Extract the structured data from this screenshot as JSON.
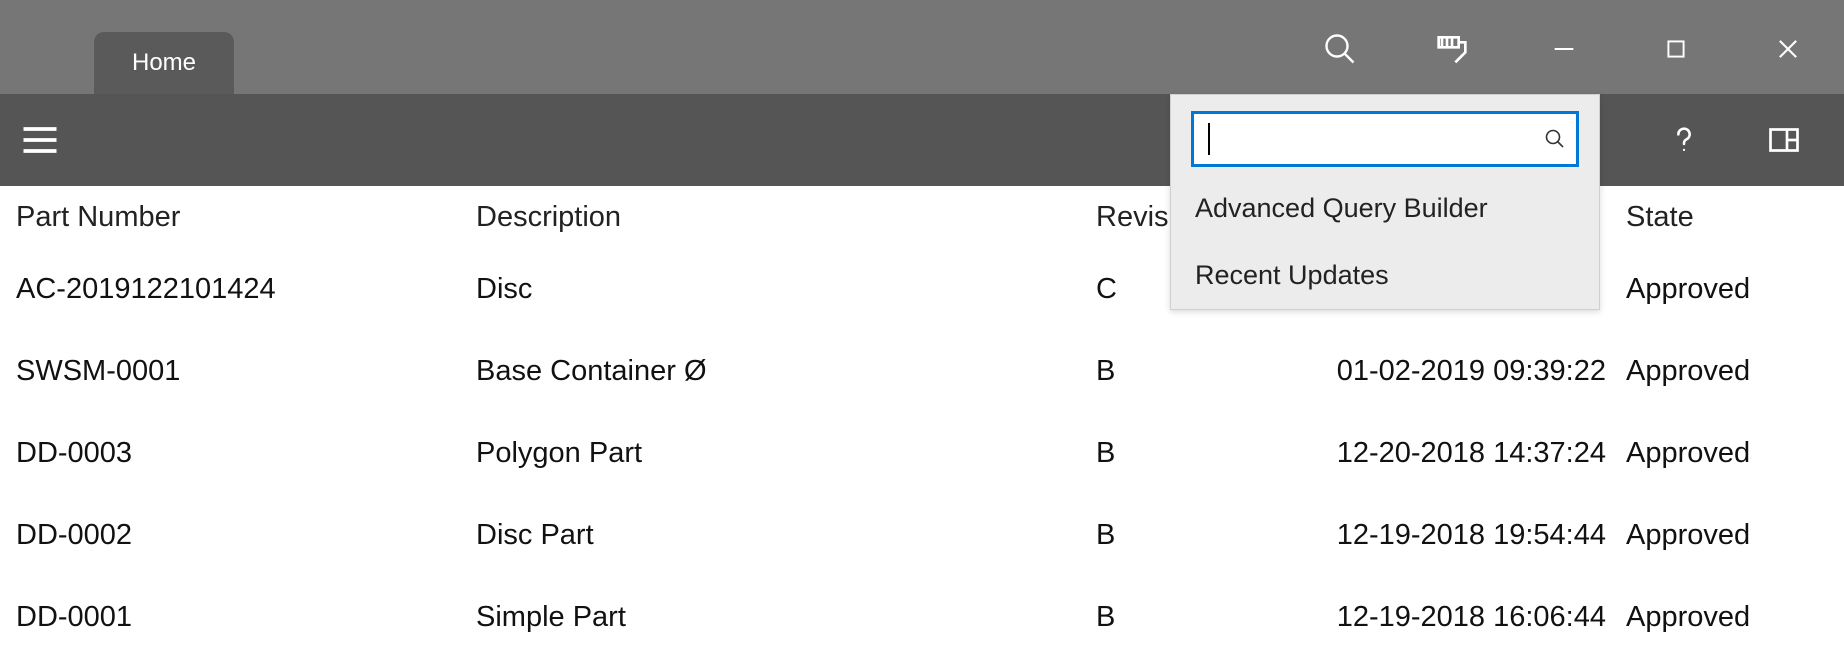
{
  "tabs": {
    "home": "Home"
  },
  "search": {
    "value": "",
    "menu": {
      "advanced": "Advanced Query Builder",
      "recent": "Recent Updates"
    }
  },
  "table": {
    "headers": {
      "part_number": "Part Number",
      "description": "Description",
      "revision": "Revision",
      "last": "",
      "state": "State"
    },
    "rows": [
      {
        "part_number": "AC-2019122101424",
        "description": "Disc",
        "revision": "C",
        "date": "",
        "state": "Approved"
      },
      {
        "part_number": "SWSM-0001",
        "description": "Base Container Ø",
        "revision": "B",
        "date": "01-02-2019 09:39:22",
        "state": "Approved"
      },
      {
        "part_number": "DD-0003",
        "description": "Polygon Part",
        "revision": "B",
        "date": "12-20-2018 14:37:24",
        "state": "Approved"
      },
      {
        "part_number": "DD-0002",
        "description": "Disc Part",
        "revision": "B",
        "date": "12-19-2018 19:54:44",
        "state": "Approved"
      },
      {
        "part_number": "DD-0001",
        "description": "Simple Part",
        "revision": "B",
        "date": "12-19-2018 16:06:44",
        "state": "Approved"
      }
    ]
  }
}
